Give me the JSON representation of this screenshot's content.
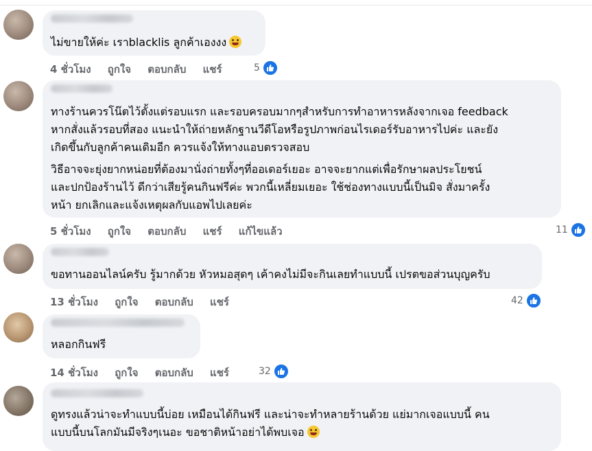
{
  "comments": [
    {
      "lines": [
        "ไม่ขายให้ค่ะ เราblacklis ลูกค้าเองงง"
      ],
      "emoji": "tongue-wink-emoji",
      "time": "4 ชั่วโมง",
      "actions": [
        "ถูกใจ",
        "ตอบกลับ",
        "แชร์"
      ],
      "likes": "5"
    },
    {
      "lines": [
        "ทางร้านควรโน๊ตไว้ตั้งแต่รอบแรก และรอบครอบมากๆสำหรับการทำอาหารหลังจากเจอ feedback",
        "หากสั่งแล้วรอบที่สอง แนะนำให้ถ่ายหลักฐานวีดีโอหรือรูปภาพก่อนไรเดอร์รับอาหารไปค่ะ และยัง",
        "เกิดขึ้นกับลูกค้าคนเดิมอีก ควรแจ้งให้ทางแอบตรวจสอบ",
        "วิธีอาจจะยุ่งยากหน่อยที่ต้องมานั่งถ่ายทั้งๆที่ออเดอร์เยอะ อาจจะยากแต่เพื่อรักษาผลประโยชน์",
        "และปกป้องร้านไว้ ดีกว่าเสียรู้คนกินฟรีค่ะ พวกนี้เหลี่ยมเยอะ ใช้ช่องทางแบบนี้เป็นมิจ สั่งมาครั้ง",
        "หน้า ยกเลิกและแจ้งเหตุผลกับแอพไปเลยค่ะ"
      ],
      "time": "5 ชั่วโมง",
      "actions": [
        "ถูกใจ",
        "ตอบกลับ",
        "แชร์",
        "แก้ไขแล้ว"
      ],
      "likes": "11"
    },
    {
      "lines": [
        "ขอทานออนไลน์ครับ รู้มากด้วย หัวหมอสุดๆ เค้าคงไม่มีจะกินเลยทำแบบนี้ เปรตขอส่วนบุญครับ"
      ],
      "time": "13 ชั่วโมง",
      "actions": [
        "ถูกใจ",
        "ตอบกลับ",
        "แชร์"
      ],
      "likes": "42"
    },
    {
      "lines": [
        "หลอกกินฟรี"
      ],
      "time": "14 ชั่วโมง",
      "actions": [
        "ถูกใจ",
        "ตอบกลับ",
        "แชร์"
      ],
      "likes": "32"
    },
    {
      "lines": [
        "ดูทรงแล้วน่าจะทำแบบนี้บ่อย เหมือนได้กินฟรี และน่าจะทำหลายร้านด้วย แย่มากเจอแบบนี้ คน",
        "แบบนี้บนโลกมันมีจริงๆเนอะ ขอชาติหน้าอย่าได้พบเจอ"
      ],
      "emoji": "grin-emoji"
    }
  ]
}
